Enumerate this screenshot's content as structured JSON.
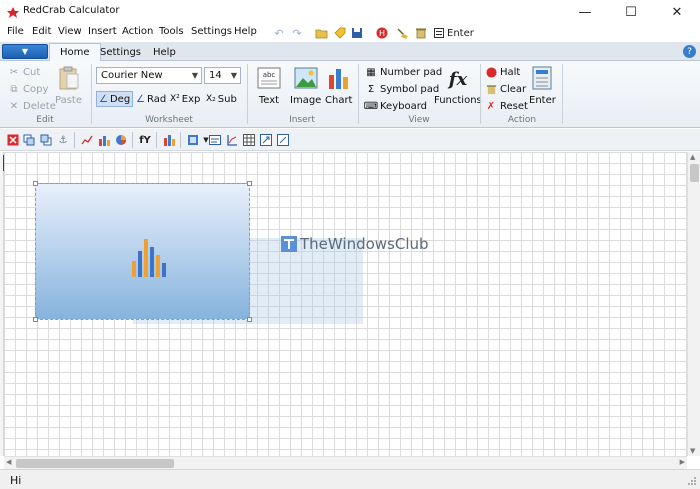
{
  "window": {
    "title": "RedCrab Calculator",
    "minimize_glyph": "—",
    "maximize_glyph": "☐",
    "close_glyph": "✕"
  },
  "menu": [
    "File",
    "Edit",
    "View",
    "Insert",
    "Action",
    "Tools",
    "Settings",
    "Help"
  ],
  "quick_access": {
    "enter_label": "Enter"
  },
  "tabs": [
    {
      "label": "Home",
      "active": true
    },
    {
      "label": "Settings",
      "active": false
    },
    {
      "label": "Help",
      "active": false
    }
  ],
  "ribbon": {
    "edit": {
      "label": "Edit",
      "cut": "Cut",
      "copy": "Copy",
      "delete": "Delete",
      "paste": "Paste"
    },
    "worksheet": {
      "label": "Worksheet",
      "font": "Courier New",
      "font_size": "14",
      "deg": "Deg",
      "rad": "Rad",
      "exp": "Exp",
      "sub": "Sub"
    },
    "insert": {
      "label": "Insert",
      "text": "Text",
      "image": "Image",
      "chart": "Chart"
    },
    "view": {
      "label": "View",
      "number_pad": "Number pad",
      "symbol_pad": "Symbol pad",
      "keyboard": "Keyboard",
      "functions": "Functions"
    },
    "action": {
      "label": "Action",
      "halt": "Halt",
      "clear": "Clear",
      "reset": "Reset",
      "enter": "Enter"
    }
  },
  "watermark": {
    "text": "TheWindowsClub"
  },
  "status": {
    "text": "Hi"
  },
  "colors": {
    "accent": "#1c5fb3",
    "bar_blue": "#3b74c8",
    "bar_orange": "#f0a030"
  }
}
